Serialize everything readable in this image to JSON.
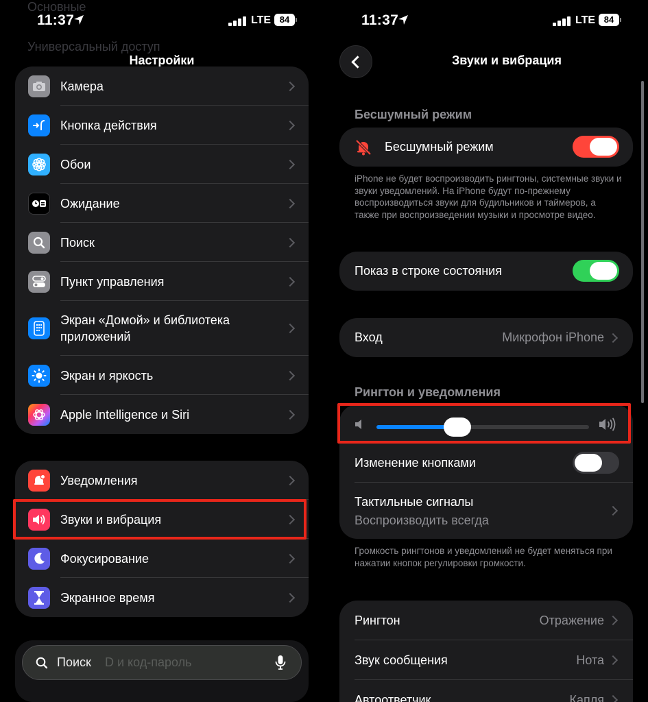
{
  "left_screen": {
    "status": {
      "time": "11:37",
      "network": "LTE",
      "battery": "84"
    },
    "nav_title": "Настройки",
    "ghost_rows": [
      "Основные",
      "Универсальный доступ"
    ],
    "group1": [
      {
        "label": "Камера",
        "icon": "camera-icon",
        "color": "#8e8e93"
      },
      {
        "label": "Кнопка действия",
        "icon": "action-button-icon",
        "color": "#0a84ff"
      },
      {
        "label": "Обои",
        "icon": "wallpaper-flower-icon",
        "color": "#30b0ff"
      },
      {
        "label": "Ожидание",
        "icon": "standby-icon",
        "color": "#1c1c1e"
      },
      {
        "label": "Поиск",
        "icon": "search-icon",
        "color": "#8e8e93"
      },
      {
        "label": "Пункт управления",
        "icon": "control-center-icon",
        "color": "#8e8e93"
      },
      {
        "label": "Экран «Домой» и библиотека приложений",
        "icon": "home-screen-icon",
        "color": "#0a84ff"
      },
      {
        "label": "Экран и яркость",
        "icon": "brightness-icon",
        "color": "#0a84ff"
      },
      {
        "label": "Apple Intelligence и Siri",
        "icon": "siri-icon",
        "color": "#bf5af2"
      }
    ],
    "group2": [
      {
        "label": "Уведомления",
        "icon": "notifications-icon",
        "color": "#ff453a"
      },
      {
        "label": "Звуки и вибрация",
        "icon": "speaker-icon",
        "color": "#ff375f"
      },
      {
        "label": "Фокусирование",
        "icon": "moon-icon",
        "color": "#5e5ce6"
      },
      {
        "label": "Экранное время",
        "icon": "hourglass-icon",
        "color": "#5e5ce6"
      }
    ],
    "search": {
      "placeholder": "Поиск",
      "behind_text": "D и код-пароль"
    }
  },
  "right_screen": {
    "status": {
      "time": "11:37",
      "network": "LTE",
      "battery": "84"
    },
    "nav_title": "Звуки и вибрация",
    "silent_section": {
      "header": "Бесшумный режим",
      "toggle_label": "Бесшумный режим",
      "toggle_on": true,
      "footnote": "iPhone не будет воспроизводить рингтоны, системные звуки и звуки уведомлений. На iPhone будут по-прежнему воспроизводиться звуки для будильников и таймеров, а также при воспроизведении музыки и просмотре видео."
    },
    "status_bar_toggle": {
      "label": "Показ в строке состояния",
      "on": true
    },
    "input": {
      "label": "Вход",
      "value": "Микрофон iPhone"
    },
    "ringer_section": {
      "header": "Рингтон и уведомления",
      "volume_level": 0.38,
      "change_with_buttons": {
        "label": "Изменение кнопками",
        "on": false
      },
      "haptics": {
        "label": "Тактильные сигналы",
        "value": "Воспроизводить всегда"
      },
      "footnote": "Громкость рингтонов и уведомлений не будет меняться при нажатии кнопок регулировки громкости."
    },
    "sounds": [
      {
        "label": "Рингтон",
        "value": "Отражение"
      },
      {
        "label": "Звук сообщения",
        "value": "Нота"
      },
      {
        "label": "Автоответчик",
        "value": "Капля"
      }
    ]
  },
  "colors": {
    "highlight": "#e8261a",
    "toggle_red": "#ff453a",
    "toggle_green": "#30d158",
    "slider_blue": "#0a84ff"
  }
}
